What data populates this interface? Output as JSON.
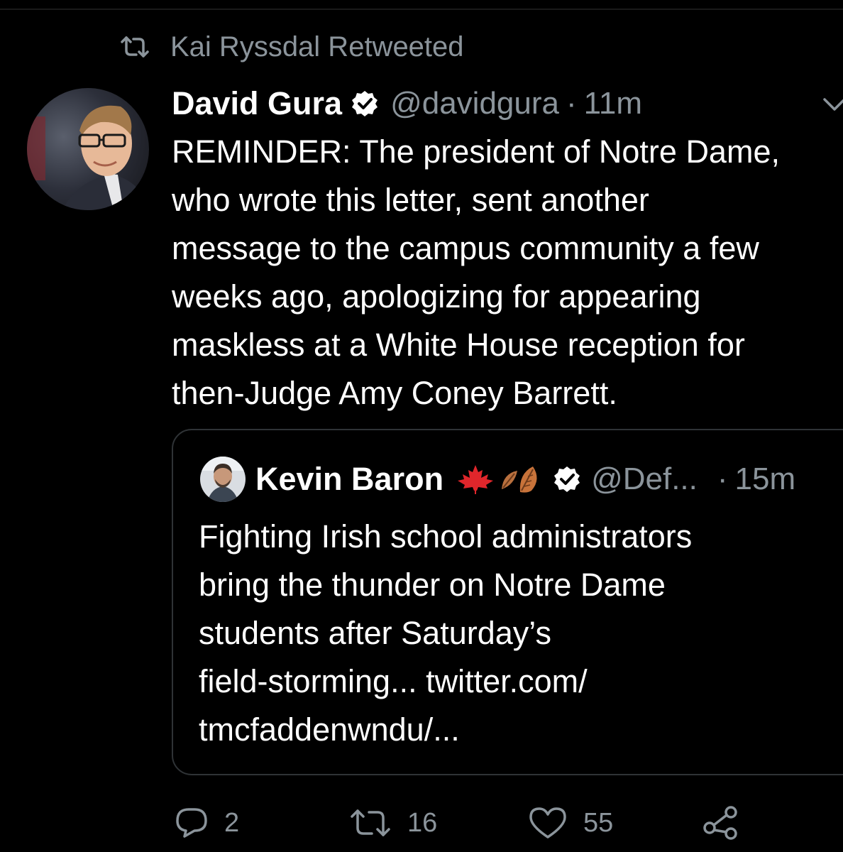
{
  "retweet_context": {
    "label": "Kai Ryssdal Retweeted",
    "icon": "retweet-icon"
  },
  "tweet": {
    "author_name": "David Gura",
    "handle": "@davidgura",
    "separator": "·",
    "time": "11m",
    "verified_icon": "verified-badge-icon",
    "more_icon": "chevron-down-icon",
    "text_lines": [
      "REMINDER: The president of Notre Dame,",
      "who wrote this letter, sent another",
      "message to the campus community a few",
      "weeks ago, apologizing for appearing",
      "maskless at a White House reception for",
      "then-Judge Amy Coney Barrett."
    ]
  },
  "quoted_tweet": {
    "author_name": "Kevin Baron",
    "emojis": [
      "maple-leaf-icon",
      "fallen-leaf-icon"
    ],
    "verified_icon": "verified-badge-icon",
    "handle": "@Def...",
    "separator": "·",
    "time": "15m",
    "text_lines": [
      "Fighting Irish school administrators",
      "bring the thunder on Notre Dame",
      "students after Saturday’s",
      "field-storming... twitter.com/",
      "tmcfaddenwndu/..."
    ]
  },
  "actions": {
    "reply_count": "2",
    "retweet_count": "16",
    "like_count": "55",
    "icons": [
      "reply-icon",
      "retweet-icon",
      "like-icon",
      "share-icon"
    ]
  },
  "colors": {
    "background": "#000000",
    "primary_text": "#ffffff",
    "secondary_text": "#8b949b",
    "card_border": "#2f3336",
    "maple_red": "#e0262b",
    "leaf_orange": "#c8733a"
  }
}
